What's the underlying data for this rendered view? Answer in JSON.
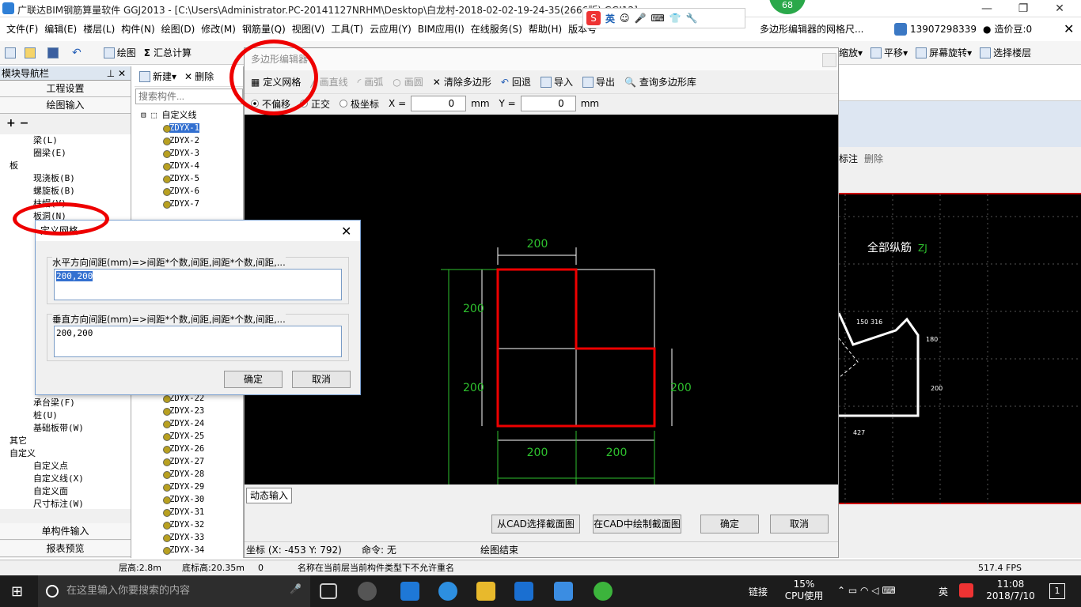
{
  "titlebar": {
    "title": "广联达BIM钢筋算量软件 GGJ2013 - [C:\\Users\\Administrator.PC-20141127NRHM\\Desktop\\白龙村-2018-02-02-19-24-35(2666版).GGJ12]",
    "badge": "68"
  },
  "ime": {
    "lang": "英"
  },
  "menu": [
    "文件(F)",
    "编辑(E)",
    "楼层(L)",
    "构件(N)",
    "绘图(D)",
    "修改(M)",
    "钢筋量(Q)",
    "视图(V)",
    "工具(T)",
    "云应用(Y)",
    "BIM应用(I)",
    "在线服务(S)",
    "帮助(H)",
    "版本号"
  ],
  "menu_right": {
    "notice": "多边形编辑器的网格尺...",
    "phone": "13907298339",
    "price": "造价豆:0"
  },
  "toolbar": {
    "draw": "绘图",
    "sum": "汇总计算",
    "zoom": "缩放",
    "pan": "平移",
    "rotate": "屏幕旋转",
    "select_floor": "选择楼层"
  },
  "leftnav": {
    "header": "模块导航栏",
    "btn_project": "工程设置",
    "btn_draw_input": "绘图输入",
    "tree": [
      "梁(L)",
      "圈梁(E)",
      "板",
      "现浇板(B)",
      "螺旋板(B)",
      "柱帽(V)",
      "板洞(N)",
      "承台梁(F)",
      "桩(U)",
      "基础板带(W)",
      "其它",
      "自定义",
      "自定义点",
      "自定义线(X)",
      "自定义面",
      "尺寸标注(W)"
    ],
    "btn_single": "单构件输入",
    "btn_report": "报表预览"
  },
  "complist": {
    "new": "新建",
    "delete": "删除",
    "search_placeholder": "搜索构件...",
    "root": "自定义线",
    "items_top": [
      "ZDYX-1",
      "ZDYX-2",
      "ZDYX-3",
      "ZDYX-4",
      "ZDYX-5",
      "ZDYX-6",
      "ZDYX-7"
    ],
    "items_bottom": [
      "ZDYX-22",
      "ZDYX-23",
      "ZDYX-24",
      "ZDYX-25",
      "ZDYX-26",
      "ZDYX-27",
      "ZDYX-28",
      "ZDYX-29",
      "ZDYX-30",
      "ZDYX-31",
      "ZDYX-32",
      "ZDYX-33",
      "ZDYX-34"
    ]
  },
  "poly": {
    "title": "多边形编辑器",
    "tools": {
      "grid": "定义网格",
      "line": "画直线",
      "arc": "画弧",
      "circle": "画圆",
      "clear": "清除多边形",
      "undo": "回退",
      "import": "导入",
      "export": "导出",
      "query": "查询多边形库"
    },
    "opts": {
      "no_offset": "不偏移",
      "ortho": "正交",
      "polar": "极坐标",
      "x_label": "X =",
      "x_val": "0",
      "y_label": "Y =",
      "y_val": "0",
      "unit": "mm"
    },
    "dims": {
      "d200": "200"
    },
    "dyn_input": "动态输入",
    "btn_cad_select": "从CAD选择截面图",
    "btn_cad_draw": "在CAD中绘制截面图",
    "btn_ok": "确定",
    "btn_cancel": "取消",
    "coord": "坐标 (X: -453 Y: 792)",
    "command": "命令: 无",
    "status": "绘图结束"
  },
  "grid_dialog": {
    "title": "定义网格",
    "h_label": "水平方向间距(mm)=>间距*个数,间距,间距*个数,间距,...",
    "h_value": "200,200",
    "v_label": "垂直方向间距(mm)=>间距*个数,间距,间距*个数,间距,...",
    "v_value": "200,200",
    "ok": "确定",
    "cancel": "取消"
  },
  "right": {
    "annot": "标注",
    "delete": "删除",
    "all_rebar": "全部纵筋",
    "zj": "ZJ",
    "n150": "150",
    "n316": "316",
    "n180": "180",
    "n200": "200",
    "n427": "427"
  },
  "statusbar": {
    "floor_h": "层高:2.8m",
    "base_h": "底标高:20.35m",
    "zero": "0",
    "msg": "名称在当前层当前构件类型下不允许重名",
    "fps": "517.4 FPS"
  },
  "taskbar": {
    "search": "在这里输入你要搜索的内容",
    "link": "链接",
    "cpu": "15%",
    "cpu_label": "CPU使用",
    "lang": "英",
    "time": "11:08",
    "date": "2018/7/10",
    "notif": "1"
  }
}
